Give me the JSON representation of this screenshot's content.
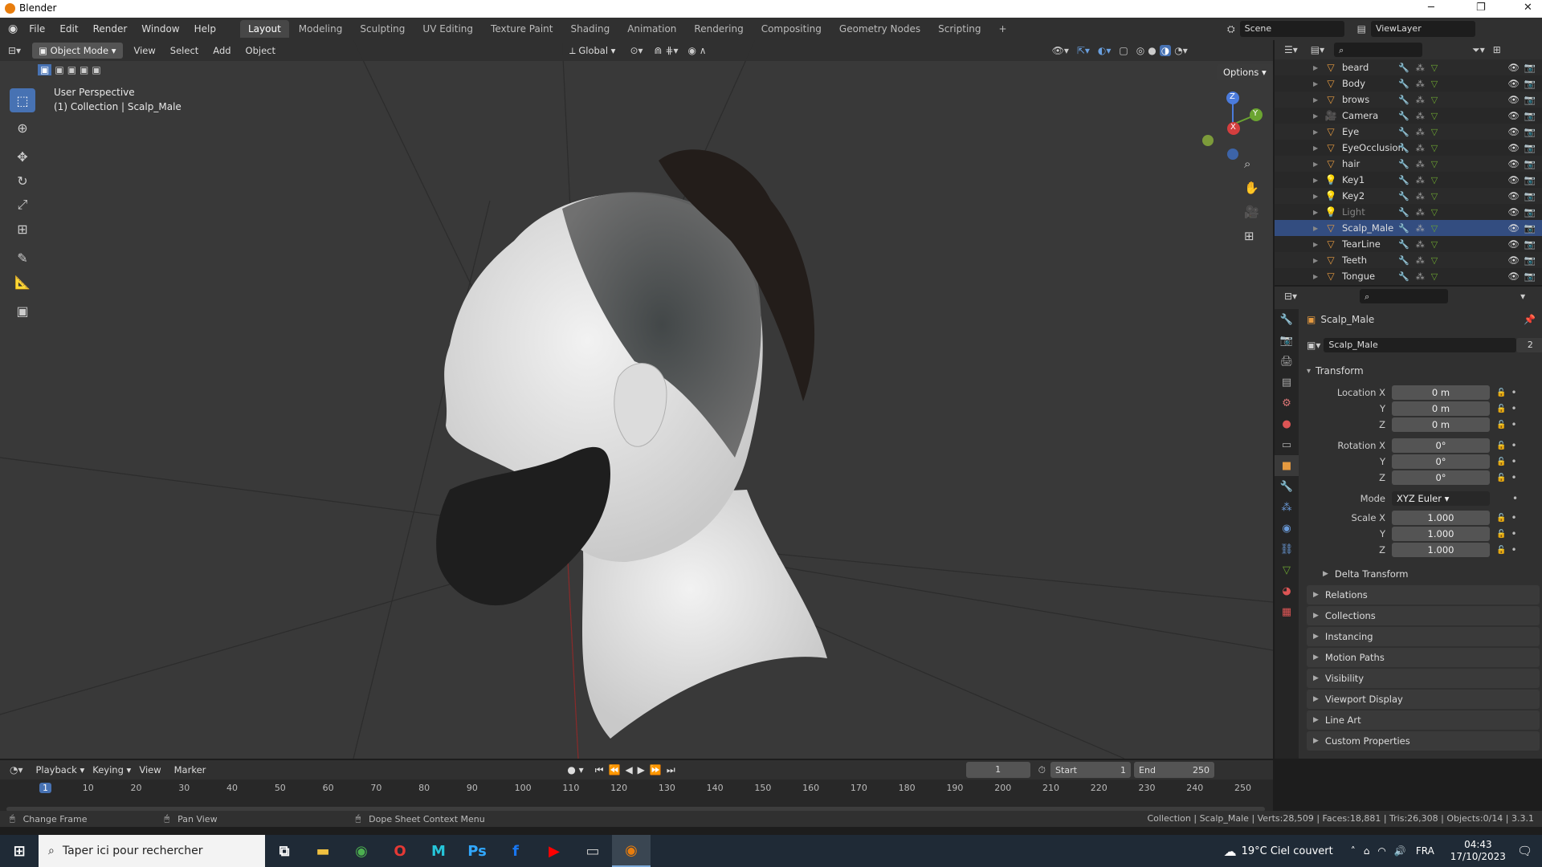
{
  "window": {
    "title": "Blender",
    "minimize": "─",
    "restore": "❐",
    "close": "✕"
  },
  "menubar": {
    "items": [
      "File",
      "Edit",
      "Render",
      "Window",
      "Help"
    ],
    "workspaces": [
      "Layout",
      "Modeling",
      "Sculpting",
      "UV Editing",
      "Texture Paint",
      "Shading",
      "Animation",
      "Rendering",
      "Compositing",
      "Geometry Nodes",
      "Scripting"
    ],
    "active_workspace": "Layout",
    "add_workspace": "+",
    "scene": "Scene",
    "view_layer": "ViewLayer"
  },
  "viewport_header": {
    "mode": "Object Mode",
    "menus": [
      "View",
      "Select",
      "Add",
      "Object"
    ],
    "orientation": "Global",
    "options": "Options"
  },
  "viewport": {
    "perspective": "User Perspective",
    "collection": "(1) Collection | Scalp_Male",
    "gizmo_z": "Z",
    "gizmo_y": "Y",
    "gizmo_x": "X"
  },
  "outliner": {
    "items": [
      {
        "name": "beard",
        "icon": "mesh-icon"
      },
      {
        "name": "Body",
        "icon": "mesh-icon"
      },
      {
        "name": "brows",
        "icon": "mesh-icon"
      },
      {
        "name": "Camera",
        "icon": "camera-icon"
      },
      {
        "name": "Eye",
        "icon": "mesh-icon"
      },
      {
        "name": "EyeOcclusion",
        "icon": "mesh-icon"
      },
      {
        "name": "hair",
        "icon": "mesh-icon"
      },
      {
        "name": "Key1",
        "icon": "light-icon"
      },
      {
        "name": "Key2",
        "icon": "light-icon"
      },
      {
        "name": "Light",
        "icon": "light-icon"
      },
      {
        "name": "Scalp_Male",
        "icon": "mesh-icon"
      },
      {
        "name": "TearLine",
        "icon": "mesh-icon"
      },
      {
        "name": "Teeth",
        "icon": "mesh-icon"
      },
      {
        "name": "Tongue",
        "icon": "mesh-icon"
      }
    ],
    "selected": "Scalp_Male"
  },
  "properties": {
    "object_name": "Scalp_Male",
    "data_name": "Scalp_Male",
    "users": "2",
    "transform_label": "Transform",
    "location_label": "Location X",
    "location": [
      "0 m",
      "0 m",
      "0 m"
    ],
    "rotation_label": "Rotation X",
    "rotation": [
      "0°",
      "0°",
      "0°"
    ],
    "mode_label": "Mode",
    "mode": "XYZ Euler",
    "scale_label": "Scale X",
    "scale": [
      "1.000",
      "1.000",
      "1.000"
    ],
    "axis_y": "Y",
    "axis_z": "Z",
    "panels": [
      "Delta Transform",
      "Relations",
      "Collections",
      "Instancing",
      "Motion Paths",
      "Visibility",
      "Viewport Display",
      "Line Art",
      "Custom Properties"
    ]
  },
  "timeline": {
    "menus": [
      "Playback",
      "Keying",
      "View",
      "Marker"
    ],
    "current_frame": "1",
    "start_label": "Start",
    "start": "1",
    "end_label": "End",
    "end": "250",
    "ticks": [
      "1",
      "10",
      "20",
      "30",
      "40",
      "50",
      "60",
      "70",
      "80",
      "90",
      "100",
      "110",
      "120",
      "130",
      "140",
      "150",
      "160",
      "170",
      "180",
      "190",
      "200",
      "210",
      "220",
      "230",
      "240",
      "250"
    ]
  },
  "statusbar": {
    "left1": "Change Frame",
    "left2": "Pan View",
    "left3": "Dope Sheet Context Menu",
    "right": "Collection | Scalp_Male | Verts:28,509 | Faces:18,881 | Tris:26,308 | Objects:0/14 | 3.3.1"
  },
  "taskbar": {
    "search": "Taper ici pour rechercher",
    "weather": "19°C Ciel couvert",
    "lang": "FRA",
    "time": "04:43",
    "date": "17/10/2023"
  },
  "colors": {
    "accent": "#4772b3",
    "orange": "#e87d0d"
  }
}
